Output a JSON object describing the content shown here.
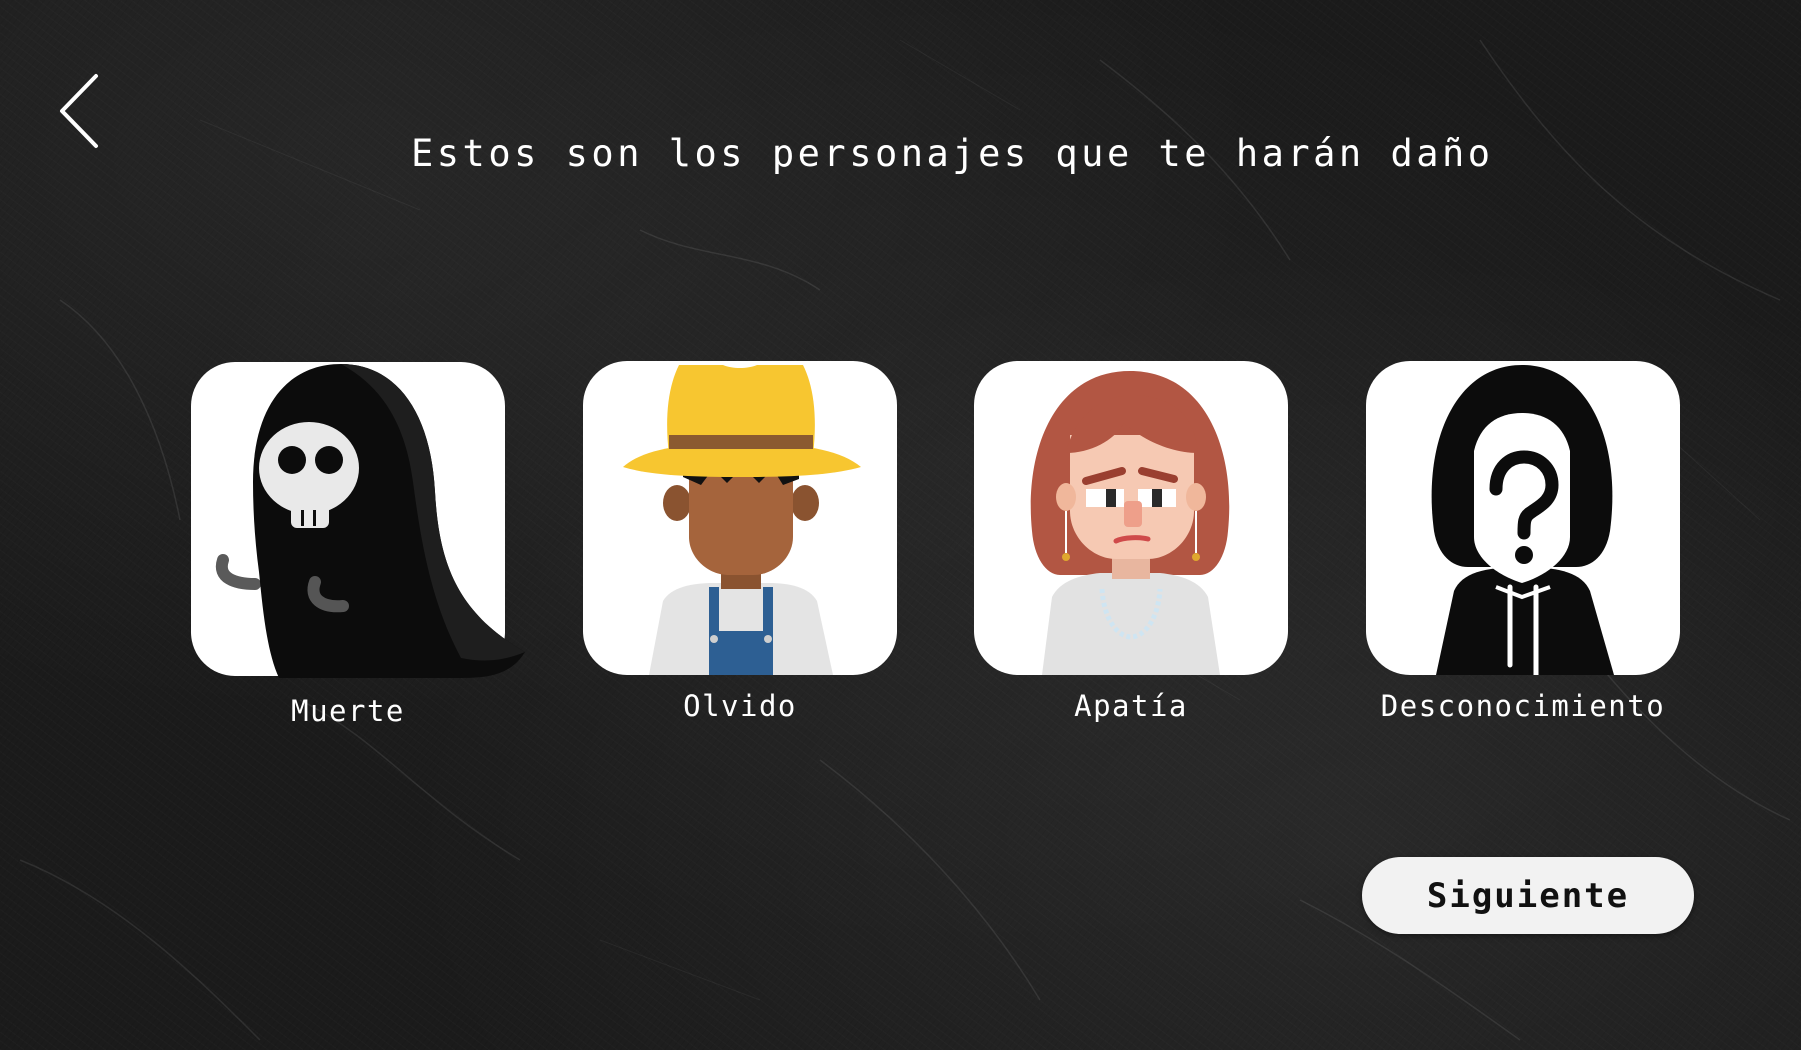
{
  "header": {
    "back_icon": "chevron-left-icon",
    "title": "Estos son los personajes que te harán daño"
  },
  "characters": [
    {
      "label": "Muerte",
      "icon": "grim-reaper-avatar"
    },
    {
      "label": "Olvido",
      "icon": "farmer-avatar"
    },
    {
      "label": "Apatía",
      "icon": "woman-avatar"
    },
    {
      "label": "Desconocimiento",
      "icon": "hooded-question-avatar"
    }
  ],
  "footer": {
    "next_label": "Siguiente"
  },
  "colors": {
    "background": "#1b1b1b",
    "card": "#ffffff",
    "button": "#f2f2f2",
    "hat": "#f7c630",
    "skin_dark": "#a5643c",
    "hair_red": "#b25643",
    "overalls": "#2d5f93"
  }
}
